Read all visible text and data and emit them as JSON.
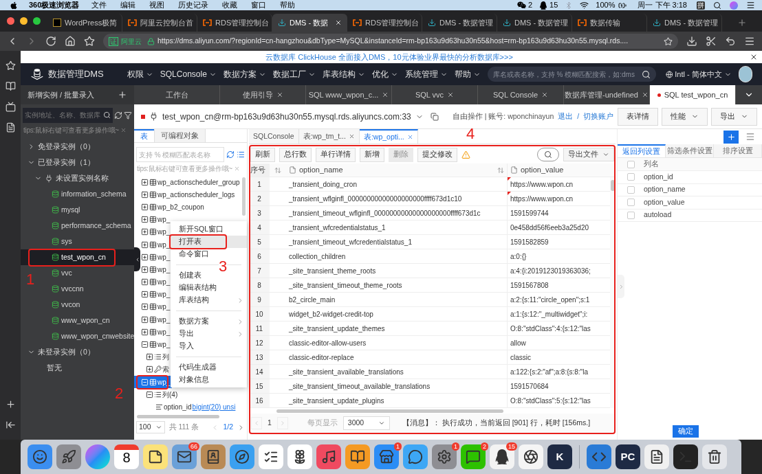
{
  "menu_bar": {
    "app": "360极速浏览器",
    "menus": [
      "文件",
      "编辑",
      "视图",
      "历史记录",
      "收藏",
      "窗口",
      "帮助"
    ],
    "wechat_count": "2",
    "qq_count": "15",
    "battery": "100%",
    "clock": "周一 下午 3:18",
    "input_method": "拼"
  },
  "browser_tabs": [
    {
      "title": "WordPress极简",
      "kind": "wp",
      "selected": false
    },
    {
      "title": "阿里云控制台首",
      "kind": "aliyun",
      "selected": false
    },
    {
      "title": "RDS管理控制台",
      "kind": "aliyun",
      "selected": false
    },
    {
      "title": "DMS - 数据",
      "kind": "dms",
      "selected": true
    },
    {
      "title": "RDS管理控制台",
      "kind": "aliyun",
      "selected": false
    },
    {
      "title": "DMS - 数据管理",
      "kind": "dms",
      "selected": false
    },
    {
      "title": "DMS - 数据管理",
      "kind": "dms",
      "selected": false
    },
    {
      "title": "数据传输",
      "kind": "aliyun",
      "selected": false
    },
    {
      "title": "DMS - 数据管理",
      "kind": "dms",
      "selected": false
    }
  ],
  "address_bar": {
    "badge_mark": "证",
    "badge_text": "阿里云",
    "url": "https://dms.aliyun.com/?regionId=cn-hangzhou&dbType=MySQL&instanceId=rm-bp163u9d63hu30n55&host=rm-bp163u9d63hu30n55.mysql.rds...."
  },
  "banner": {
    "text": "云数据库 ClickHouse 全面接入DMS，10元体验业界最快的分析数据库>>>"
  },
  "dms_header": {
    "logo_text": "数据管理DMS",
    "menus": [
      "权限",
      "SQLConsole",
      "数据方案",
      "数据工厂",
      "库表结构",
      "优化",
      "系统管理",
      "帮助"
    ],
    "search_placeholder": "库名或表名称，支持 % 模糊匹配搜索，如:dms",
    "language": "Intl - 简体中文"
  },
  "instance_panel": {
    "title": "新增实例 / 批量录入",
    "search_placeholder": "实例地址、名称、数据库",
    "tips": "tips:鼠标右键可查看更多操作哦~",
    "tree": [
      {
        "label": "免登录实例（0）",
        "kind": "group",
        "expanded": false
      },
      {
        "label": "已登录实例（1）",
        "kind": "group",
        "expanded": true,
        "children": [
          {
            "label": "未设置实例名称",
            "kind": "instance",
            "expanded": true,
            "children": [
              {
                "label": "information_schema",
                "kind": "database",
                "selected": false
              },
              {
                "label": "mysql",
                "kind": "database",
                "selected": false
              },
              {
                "label": "performance_schema",
                "kind": "database",
                "selected": false
              },
              {
                "label": "sys",
                "kind": "database",
                "selected": false
              },
              {
                "label": "test_wpon_cn",
                "kind": "database",
                "selected": true
              },
              {
                "label": "vvc",
                "kind": "database",
                "selected": false
              },
              {
                "label": "vvccnn",
                "kind": "database",
                "selected": false
              },
              {
                "label": "vvcon",
                "kind": "database",
                "selected": false
              },
              {
                "label": "www_wpon_cn",
                "kind": "database",
                "selected": false
              },
              {
                "label": "www_wpon_cnwebsite",
                "kind": "database",
                "selected": false
              }
            ]
          }
        ]
      },
      {
        "label": "未登录实例（0）",
        "kind": "group",
        "expanded": true,
        "children": [
          {
            "label": "暂无",
            "kind": "empty"
          }
        ]
      }
    ]
  },
  "workspace_tabs": [
    {
      "title": "工作台",
      "closable": false,
      "selected": false
    },
    {
      "title": "使用引导",
      "closable": true,
      "selected": false
    },
    {
      "title": "SQL www_wpon_c...",
      "closable": true,
      "selected": false
    },
    {
      "title": "SQL vvc",
      "closable": true,
      "selected": false
    },
    {
      "title": "SQL Console",
      "closable": true,
      "selected": false
    },
    {
      "title": "数据库管理-undefined",
      "closable": true,
      "selected": false
    },
    {
      "title": "SQL test_wpon_cn",
      "closable": false,
      "selected": true
    }
  ],
  "connection": {
    "name": "test_wpon_cn@rm-bp163u9d63hu30n55.mysql.rds.aliyuncs.com:33",
    "mode": "自由操作 | 账号: wponchinayun",
    "logout": "退出",
    "separator": "/",
    "switch": "切换账户",
    "buttons": [
      {
        "label": "表详情",
        "dropdown": false
      },
      {
        "label": "性能",
        "dropdown": true
      },
      {
        "label": "导出",
        "dropdown": true
      }
    ]
  },
  "object_panel": {
    "tabs": [
      {
        "label": "表",
        "selected": true
      },
      {
        "label": "可编程对象",
        "selected": false
      }
    ],
    "search_placeholder": "支持 % 模糊匹配表名称",
    "tips": "tips:鼠标右键可查看更多操作哦~",
    "items": [
      {
        "name": "wp_actionscheduler_group",
        "kind": "table",
        "expanded": false,
        "selected": false
      },
      {
        "name": "wp_actionscheduler_logs",
        "kind": "table",
        "expanded": false,
        "selected": false
      },
      {
        "name": "wp_b2_coupon",
        "kind": "table",
        "expanded": false,
        "selected": false
      },
      {
        "name": "wp_",
        "kind": "table",
        "expanded": false,
        "selected": false
      },
      {
        "name": "wp_",
        "kind": "table",
        "expanded": false,
        "selected": false
      },
      {
        "name": "wp_",
        "kind": "table",
        "expanded": false,
        "selected": false
      },
      {
        "name": "wp_",
        "kind": "table",
        "expanded": false,
        "selected": false
      },
      {
        "name": "wp_",
        "kind": "table",
        "expanded": false,
        "selected": false
      },
      {
        "name": "wp_",
        "kind": "table",
        "expanded": false,
        "selected": false
      },
      {
        "name": "wp_",
        "kind": "table",
        "expanded": false,
        "selected": false
      },
      {
        "name": "wp_",
        "kind": "table",
        "expanded": false,
        "selected": false
      },
      {
        "name": "wp_",
        "kind": "table",
        "expanded": false,
        "selected": false
      },
      {
        "name": "wp_",
        "kind": "table",
        "expanded": false,
        "selected": false
      },
      {
        "name": "wp_",
        "kind": "table",
        "expanded": true,
        "selected": false,
        "children": [
          {
            "name": "列",
            "kind": "columns",
            "expanded": false,
            "selected": false
          },
          {
            "name": "索",
            "kind": "index",
            "expanded": false,
            "selected": false
          }
        ]
      },
      {
        "name": "wp_",
        "kind": "table",
        "expanded": true,
        "selected": true,
        "children": [
          {
            "name": "列(4)",
            "kind": "columns",
            "expanded": true,
            "selected": false,
            "children": [
              {
                "name": "option_id",
                "kind": "column",
                "type": "bigint(20) unsi",
                "selected": false
              }
            ]
          }
        ]
      }
    ],
    "page_size": "100",
    "total": "共 111 条",
    "page": "1/2"
  },
  "context_menu": {
    "groups": [
      {
        "items": [
          {
            "label": "新开SQL窗口",
            "submenu": false,
            "selected": false
          },
          {
            "label": "打开表",
            "submenu": false,
            "selected": true
          },
          {
            "label": "命令窗口",
            "submenu": false,
            "selected": false
          }
        ]
      },
      {
        "items": [
          {
            "label": "创建表",
            "submenu": false,
            "selected": false
          },
          {
            "label": "编辑表结构",
            "submenu": false,
            "selected": false
          },
          {
            "label": "库表结构",
            "submenu": true,
            "selected": false
          }
        ]
      },
      {
        "items": [
          {
            "label": "数据方案",
            "submenu": true,
            "selected": false
          },
          {
            "label": "导出",
            "submenu": true,
            "selected": false
          },
          {
            "label": "导入",
            "submenu": false,
            "selected": false
          }
        ]
      },
      {
        "items": [
          {
            "label": "代码生成器",
            "submenu": false,
            "selected": false
          },
          {
            "label": "对象信息",
            "submenu": false,
            "selected": false
          }
        ]
      }
    ]
  },
  "result_tabs": [
    {
      "label": "SQLConsole",
      "closable": false,
      "selected": false
    },
    {
      "label": "表:wp_tm_t...",
      "closable": true,
      "selected": false
    },
    {
      "label": "表:wp_opti...",
      "closable": true,
      "selected": true
    }
  ],
  "toolbar": {
    "buttons": [
      {
        "label": "刷新",
        "disabled": false
      },
      {
        "label": "总行数",
        "disabled": false
      },
      {
        "label": "单行详情",
        "disabled": false
      },
      {
        "label": "新增",
        "disabled": false
      },
      {
        "label": "删除",
        "disabled": true
      },
      {
        "label": "提交修改",
        "disabled": false
      }
    ],
    "export": "导出文件"
  },
  "table": {
    "columns": [
      "序号",
      "option_name",
      "option_value"
    ],
    "rows": [
      {
        "index": "1",
        "option_name": "_transient_doing_cron",
        "option_value": "https://www.wpon.cn",
        "flagged": true
      },
      {
        "index": "2",
        "option_name": "_transient_wflginfl_00000000000000000000ffff673d1c10",
        "option_value": "https://www.wpon.cn",
        "flagged": true
      },
      {
        "index": "3",
        "option_name": "_transient_timeout_wflginfl_00000000000000000000ffff673d1c",
        "option_value": "1591599744",
        "flagged": false
      },
      {
        "index": "4",
        "option_name": "_transient_wfcredentialstatus_1",
        "option_value": "0e458dd56f6eeb3a25d20",
        "flagged": false
      },
      {
        "index": "5",
        "option_name": "_transient_timeout_wfcredentialstatus_1",
        "option_value": "1591582859",
        "flagged": false
      },
      {
        "index": "6",
        "option_name": "collection_children",
        "option_value": "a:0:{}",
        "flagged": false
      },
      {
        "index": "7",
        "option_name": "_site_transient_theme_roots",
        "option_value": "a:4:{i:2019123019363036;",
        "flagged": false
      },
      {
        "index": "8",
        "option_name": "_site_transient_timeout_theme_roots",
        "option_value": "1591567808",
        "flagged": false
      },
      {
        "index": "9",
        "option_name": "b2_circle_main",
        "option_value": "a:2:{s:11:\"circle_open\";s:1",
        "flagged": false
      },
      {
        "index": "10",
        "option_name": "widget_b2-widget-credit-top",
        "option_value": "a:1:{s:12:\"_multiwidget\";i:",
        "flagged": false
      },
      {
        "index": "11",
        "option_name": "_site_transient_update_themes",
        "option_value": "O:8:\"stdClass\":4:{s:12:\"las",
        "flagged": false
      },
      {
        "index": "12",
        "option_name": "classic-editor-allow-users",
        "option_value": "allow",
        "flagged": false
      },
      {
        "index": "13",
        "option_name": "classic-editor-replace",
        "option_value": "classic",
        "flagged": false
      },
      {
        "index": "14",
        "option_name": "_site_transient_available_translations",
        "option_value": "a:122:{s:2:\"af\";a:8:{s:8:\"la",
        "flagged": false
      },
      {
        "index": "15",
        "option_name": "_site_transient_timeout_available_translations",
        "option_value": "1591570684",
        "flagged": false
      },
      {
        "index": "16",
        "option_name": "_site_transient_update_plugins",
        "option_value": "O:8:\"stdClass\":5:{s:12:\"las",
        "flagged": false
      }
    ]
  },
  "pagination": {
    "page": "1",
    "per_page_label": "每页显示",
    "per_page": "3000",
    "message": "【消息】： 执行成功，当前返回 [901] 行，耗时 [156ms.]"
  },
  "settings_panel": {
    "tabs": [
      {
        "label": "返回列设置",
        "selected": true
      },
      {
        "label": "筛选条件设置",
        "selected": false
      },
      {
        "label": "排序设置",
        "selected": false
      }
    ],
    "header": "列名",
    "header_checked": false,
    "columns": [
      {
        "name": "option_id",
        "checked": false
      },
      {
        "name": "option_name",
        "checked": false
      },
      {
        "name": "option_value",
        "checked": false
      },
      {
        "name": "autoload",
        "checked": false
      }
    ],
    "confirm": "确定"
  },
  "annotations": [
    {
      "label": "1"
    },
    {
      "label": "2"
    },
    {
      "label": "3"
    },
    {
      "label": "4"
    }
  ],
  "dock": [
    {
      "kind": "finder"
    },
    {
      "kind": "rocket"
    },
    {
      "kind": "siri"
    },
    {
      "kind": "calendar",
      "label": "8"
    },
    {
      "kind": "notes"
    },
    {
      "kind": "mail",
      "badge": "66"
    },
    {
      "kind": "contacts"
    },
    {
      "kind": "compass"
    },
    {
      "kind": "reminders"
    },
    {
      "kind": "photos"
    },
    {
      "kind": "music"
    },
    {
      "kind": "books"
    },
    {
      "kind": "store",
      "badge": "1"
    },
    {
      "kind": "messages"
    },
    {
      "kind": "settings",
      "badge": "1"
    },
    {
      "kind": "chat",
      "badge": "2"
    },
    {
      "kind": "penguin",
      "badge": "15"
    },
    {
      "kind": "aperture"
    },
    {
      "kind": "letter",
      "label": "K"
    },
    {
      "kind": "divider"
    },
    {
      "kind": "code"
    },
    {
      "kind": "letter",
      "label": "PC"
    },
    {
      "kind": "document"
    },
    {
      "kind": "terminal"
    },
    {
      "kind": "trash"
    }
  ]
}
